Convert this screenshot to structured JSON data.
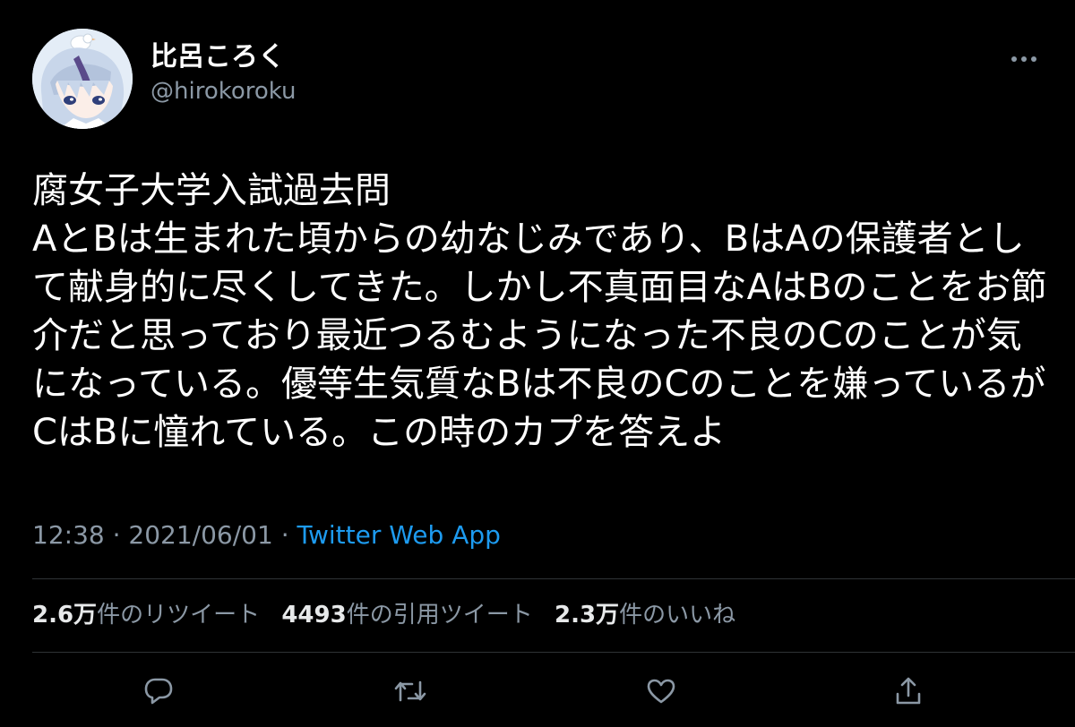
{
  "user": {
    "display_name": "比呂ころく",
    "handle": "@hirokoroku"
  },
  "tweet": {
    "lines": [
      "腐女子大学入試過去問",
      "AとBは生まれた頃からの幼なじみであり、BはAの保護者とし",
      "て献身的に尽くしてきた。しかし不真面目なAはBのことをお節",
      "介だと思っており最近つるむようになった不良のCのことが気",
      "になっている。優等生気質なBは不良のCのことを嫌っているが",
      "CはBに憧れている。この時のカプを答えよ"
    ]
  },
  "meta": {
    "time": "12:38",
    "separator": " · ",
    "date": "2021/06/01",
    "source": "Twitter Web App"
  },
  "stats": {
    "retweets_count": "2.6万",
    "retweets_label": "件のリツイート",
    "quotes_count": "4493",
    "quotes_label": "件の引用ツイート",
    "likes_count": "2.3万",
    "likes_label": "件のいいね"
  },
  "icons": {
    "more": "more-horizontal-icon",
    "reply": "reply-icon",
    "retweet": "retweet-icon",
    "like": "like-icon",
    "share": "share-icon"
  },
  "colors": {
    "background": "#000000",
    "text_primary": "#ffffff",
    "text_secondary": "#8b98a5",
    "link": "#1d9bf0",
    "divider": "#2f3336"
  }
}
